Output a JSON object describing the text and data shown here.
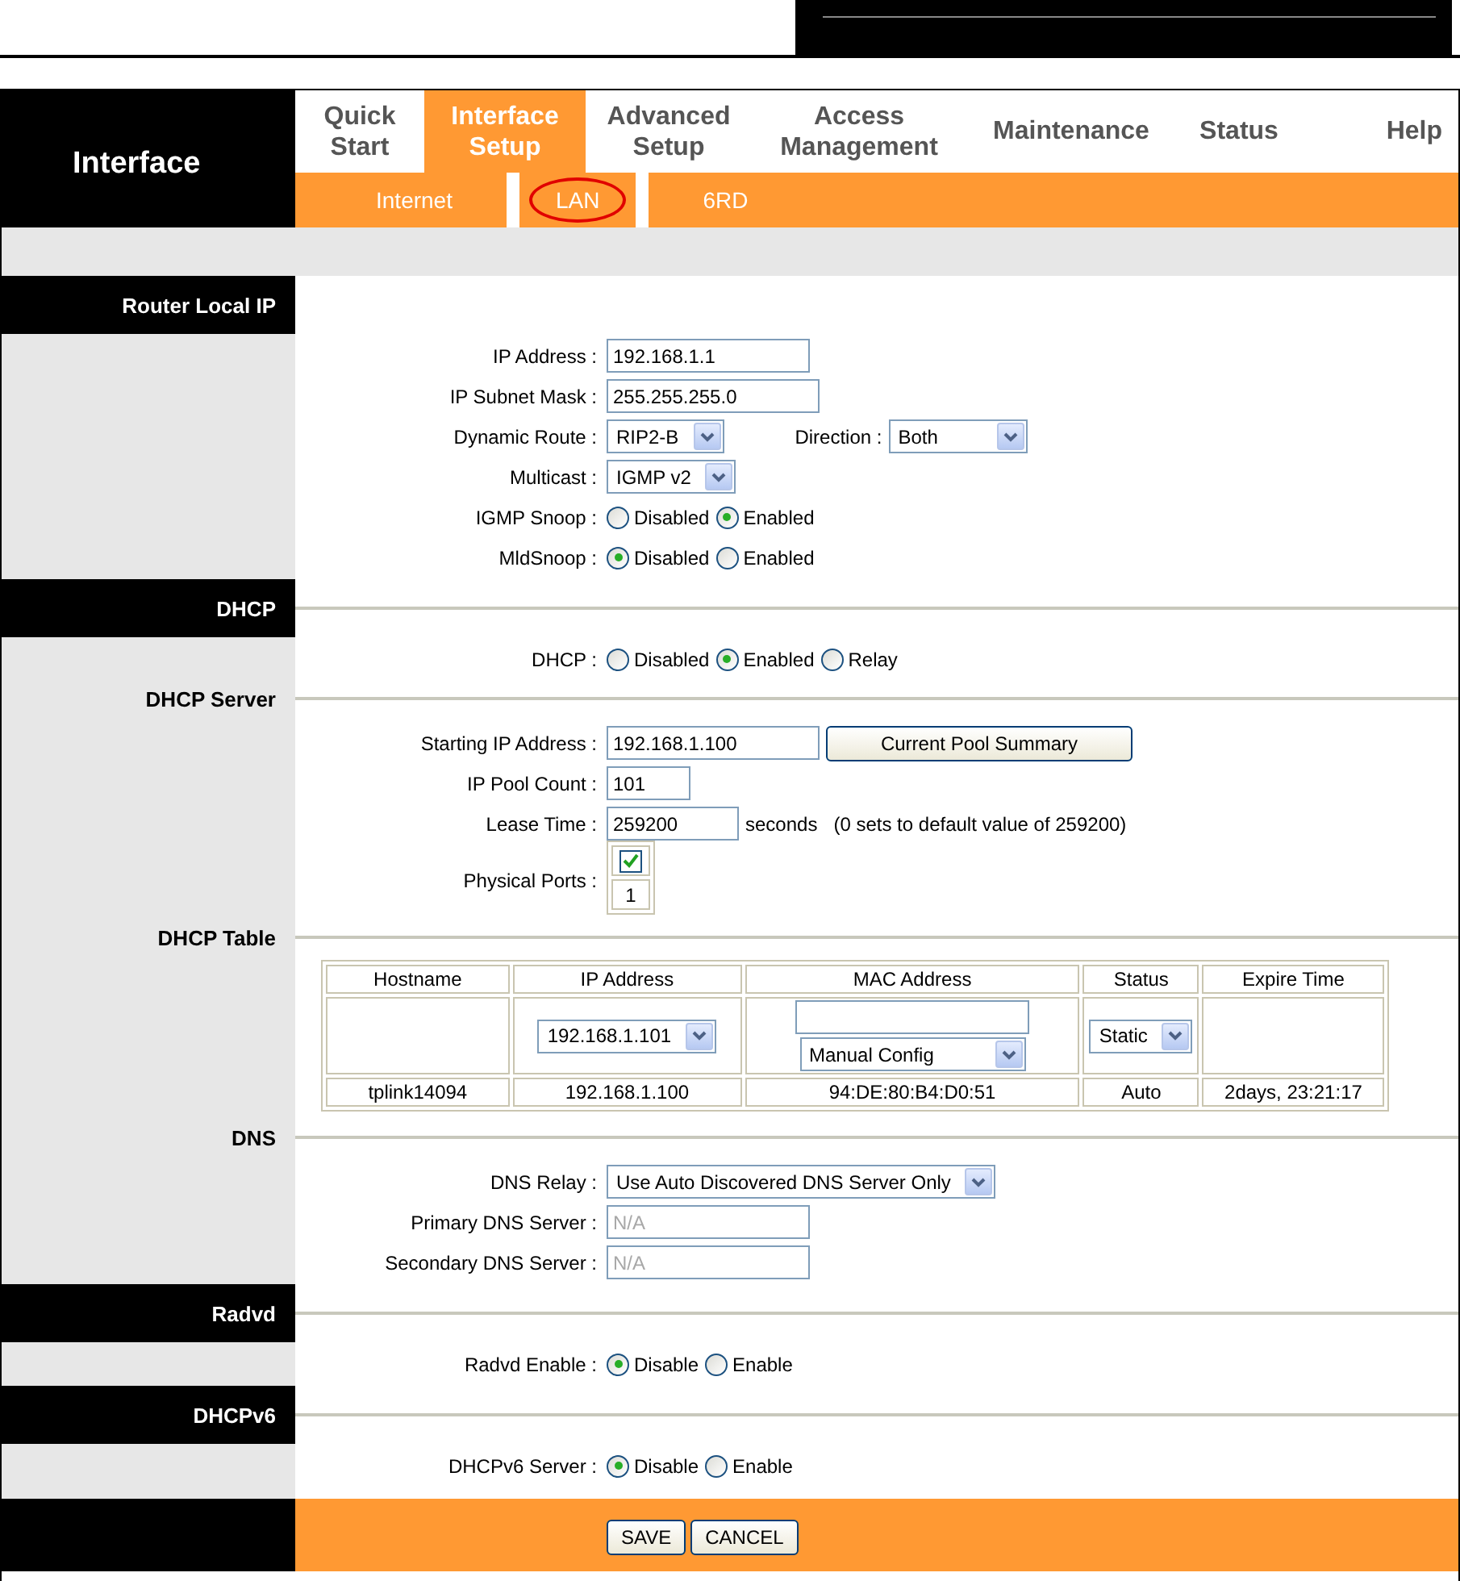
{
  "header": {
    "title": "Interface"
  },
  "tabs": [
    {
      "label": "Quick Start",
      "selected": false
    },
    {
      "label": "Interface Setup",
      "selected": true
    },
    {
      "label": "Advanced Setup",
      "selected": false
    },
    {
      "label": "Access Management",
      "selected": false
    },
    {
      "label": "Maintenance",
      "selected": false
    },
    {
      "label": "Status",
      "selected": false
    },
    {
      "label": "Help",
      "selected": false
    }
  ],
  "subtabs": [
    {
      "label": "Internet",
      "selected": false,
      "circled": false
    },
    {
      "label": "LAN",
      "selected": true,
      "circled": true
    },
    {
      "label": "6RD",
      "selected": false,
      "circled": false
    }
  ],
  "sections": [
    {
      "title": "Router Local IP",
      "kind": "major",
      "rows": [
        {
          "label": "IP Address :",
          "controls": [
            {
              "kind": "text",
              "value": "192.168.1.1",
              "disabled": false
            }
          ]
        },
        {
          "label": "IP Subnet Mask :",
          "controls": [
            {
              "kind": "text",
              "value": "255.255.255.0",
              "disabled": false
            }
          ]
        },
        {
          "label": "Dynamic Route :",
          "controls": [
            {
              "kind": "select",
              "value": "RIP2-B"
            },
            {
              "kind": "label",
              "text": "Direction :"
            },
            {
              "kind": "select",
              "value": "Both"
            }
          ]
        },
        {
          "label": "Multicast :",
          "controls": [
            {
              "kind": "select",
              "value": "IGMP v2"
            }
          ]
        },
        {
          "label": "IGMP Snoop :",
          "controls": [
            {
              "kind": "radio",
              "options": [
                {
                  "label": "Disabled",
                  "selected": false
                },
                {
                  "label": "Enabled",
                  "selected": true
                }
              ]
            }
          ]
        },
        {
          "label": "MldSnoop :",
          "controls": [
            {
              "kind": "radio",
              "options": [
                {
                  "label": "Disabled",
                  "selected": true
                },
                {
                  "label": "Enabled",
                  "selected": false
                }
              ]
            }
          ]
        }
      ]
    },
    {
      "title": "DHCP",
      "kind": "major",
      "rows": [
        {
          "label": "DHCP :",
          "controls": [
            {
              "kind": "radio",
              "options": [
                {
                  "label": "Disabled",
                  "selected": false
                },
                {
                  "label": "Enabled",
                  "selected": true
                },
                {
                  "label": "Relay",
                  "selected": false
                }
              ]
            }
          ]
        }
      ]
    },
    {
      "title": "DHCP Server",
      "kind": "minor",
      "rows": [
        {
          "label": "Starting IP Address :",
          "controls": [
            {
              "kind": "text",
              "value": "192.168.1.100",
              "disabled": false
            },
            {
              "kind": "button",
              "label": "Current Pool Summary"
            }
          ]
        },
        {
          "label": "IP Pool Count :",
          "controls": [
            {
              "kind": "text",
              "value": "101",
              "disabled": false
            }
          ]
        },
        {
          "label": "Lease Time :",
          "controls": [
            {
              "kind": "text",
              "value": "259200",
              "disabled": false
            },
            {
              "kind": "note",
              "text": "seconds"
            },
            {
              "kind": "note",
              "text": "(0 sets to default value of 259200)"
            }
          ]
        },
        {
          "label": "Physical Ports :",
          "controls": [
            {
              "kind": "ports",
              "ports": [
                {
                  "label": "1",
                  "checked": true
                }
              ]
            }
          ]
        }
      ]
    },
    {
      "title": "DHCP Table",
      "kind": "minor",
      "table": {
        "columns": [
          "Hostname",
          "IP Address",
          "MAC Address",
          "Status",
          "Expire Time"
        ],
        "edit_row": [
          {
            "kind": "blank"
          },
          {
            "kind": "select",
            "value": "192.168.1.101"
          },
          {
            "kind": "mac",
            "select": "Manual Config"
          },
          {
            "kind": "select",
            "value": "Static"
          },
          {
            "kind": "blank"
          }
        ],
        "rows": [
          [
            "tplink14094",
            "192.168.1.100",
            "94:DE:80:B4:D0:51",
            "Auto",
            "2days, 23:21:17"
          ]
        ]
      }
    },
    {
      "title": "DNS",
      "kind": "minor",
      "rows": [
        {
          "label": "DNS Relay :",
          "controls": [
            {
              "kind": "select",
              "value": "Use Auto Discovered DNS Server Only"
            }
          ]
        },
        {
          "label": "Primary DNS Server :",
          "controls": [
            {
              "kind": "text",
              "value": "N/A",
              "disabled": true
            }
          ]
        },
        {
          "label": "Secondary DNS Server :",
          "controls": [
            {
              "kind": "text",
              "value": "N/A",
              "disabled": true
            }
          ]
        }
      ]
    },
    {
      "title": "Radvd",
      "kind": "major",
      "rows": [
        {
          "label": "Radvd Enable :",
          "controls": [
            {
              "kind": "radio",
              "options": [
                {
                  "label": "Disable",
                  "selected": true
                },
                {
                  "label": "Enable",
                  "selected": false
                }
              ]
            }
          ]
        }
      ]
    },
    {
      "title": "DHCPv6",
      "kind": "major",
      "rows": [
        {
          "label": "DHCPv6 Server :",
          "controls": [
            {
              "kind": "radio",
              "options": [
                {
                  "label": "Disable",
                  "selected": true
                },
                {
                  "label": "Enable",
                  "selected": false
                }
              ]
            }
          ]
        }
      ]
    }
  ],
  "footer": {
    "buttons": [
      "SAVE",
      "CANCEL"
    ]
  }
}
